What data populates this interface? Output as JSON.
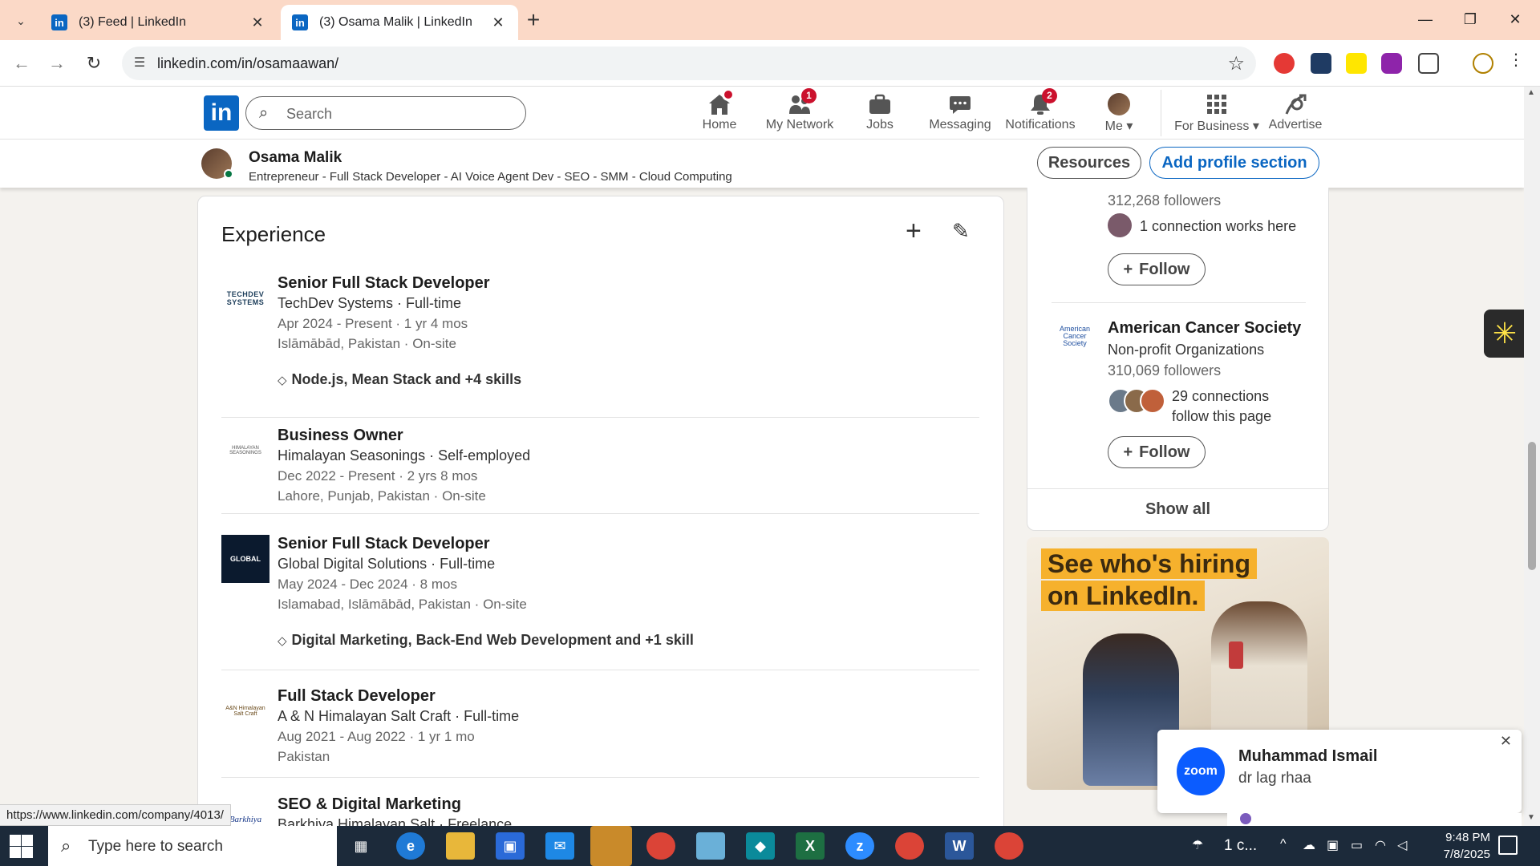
{
  "browser": {
    "tabs": [
      {
        "title": "(3) Feed | LinkedIn",
        "active": false
      },
      {
        "title": "(3) Osama Malik | LinkedIn",
        "active": true
      }
    ],
    "url": "linkedin.com/in/osamaawan/",
    "status_url": "https://www.linkedin.com/company/4013/"
  },
  "linkedin": {
    "logo": "in",
    "search_placeholder": "Search",
    "nav": [
      {
        "label": "Home",
        "icon": "home-icon",
        "badge": "dot"
      },
      {
        "label": "My Network",
        "icon": "network-icon",
        "badge": "1"
      },
      {
        "label": "Jobs",
        "icon": "briefcase-icon",
        "badge": ""
      },
      {
        "label": "Messaging",
        "icon": "chat-icon",
        "badge": ""
      },
      {
        "label": "Notifications",
        "icon": "bell-icon",
        "badge": "2"
      },
      {
        "label": "Me",
        "icon": "avatar",
        "badge": ""
      },
      {
        "label": "For Business",
        "icon": "grid-icon",
        "badge": ""
      },
      {
        "label": "Advertise",
        "icon": "advertise-icon",
        "badge": ""
      }
    ],
    "colors": {
      "brand": "#0a66c2",
      "badge": "#cb112d",
      "online": "#057642"
    }
  },
  "profile_bar": {
    "name": "Osama Malik",
    "headline": "Entrepreneur - Full Stack Developer - AI Voice Agent Dev - SEO - SMM - Cloud Computing",
    "resources_label": "Resources",
    "add_section_label": "Add profile section"
  },
  "experience": {
    "title": "Experience",
    "jobs": [
      {
        "title": "Senior Full Stack Developer",
        "company": "TechDev Systems · Full-time",
        "dates": "Apr 2024 - Present · 1 yr 4 mos",
        "location": "Islāmābād, Pakistan · On-site",
        "skills": "Node.js, Mean Stack and +4 skills",
        "logo_text": "TECHDEV SYSTEMS"
      },
      {
        "title": "Business Owner",
        "company": "Himalayan Seasonings · Self-employed",
        "dates": "Dec 2022 - Present · 2 yrs 8 mos",
        "location": "Lahore, Punjab, Pakistan · On-site",
        "skills": "",
        "logo_text": "HIMALAYAN SEASONINGS"
      },
      {
        "title": "Senior Full Stack Developer",
        "company": "Global Digital Solutions · Full-time",
        "dates": "May 2024 - Dec 2024 · 8 mos",
        "location": "Islamabad, Islāmābād, Pakistan · On-site",
        "skills": "Digital Marketing, Back-End Web Development and +1 skill",
        "logo_text": "GLOBAL"
      },
      {
        "title": "Full Stack Developer",
        "company": "A & N Himalayan Salt Craft · Full-time",
        "dates": "Aug 2021 - Aug 2022 · 1 yr 1 mo",
        "location": "Pakistan",
        "skills": "",
        "logo_text": "A&N Himalayan Salt Craft"
      },
      {
        "title": "SEO & Digital Marketing",
        "company": "Barkhiya Himalayan Salt · Freelance",
        "dates": "",
        "location": "",
        "skills": "",
        "logo_text": "Barkhiya"
      }
    ]
  },
  "right_rail": {
    "top_followers": "312,268 followers",
    "top_connection": "1 connection works here",
    "follow_label": "Follow",
    "org_name": "American Cancer Society",
    "org_type": "Non-profit Organizations",
    "org_followers": "310,069 followers",
    "org_logo_text": "American Cancer Society",
    "org_connections": "29 connections follow this page",
    "show_all": "Show all",
    "ad_line1": "See who's hiring",
    "ad_line2": "on LinkedIn."
  },
  "toast": {
    "app": "zoom",
    "sender": "Muhammad Ismail",
    "message": "dr lag rhaa"
  },
  "taskbar": {
    "search_placeholder": "Type here to search",
    "weather": "1 c...",
    "time": "9:48 PM",
    "date": "7/8/2025"
  }
}
